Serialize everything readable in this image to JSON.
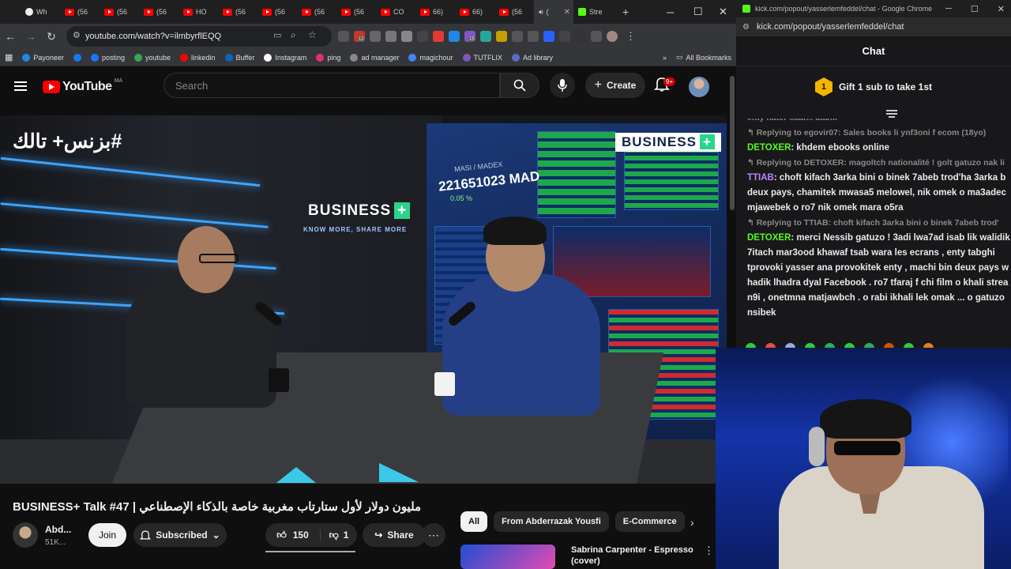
{
  "browser": {
    "tabs": [
      {
        "label": "Wh",
        "type": "chrome"
      },
      {
        "label": "(56",
        "type": "yt"
      },
      {
        "label": "(56",
        "type": "yt"
      },
      {
        "label": "(56",
        "type": "yt"
      },
      {
        "label": "HO",
        "type": "yt"
      },
      {
        "label": "(56",
        "type": "yt"
      },
      {
        "label": "(56",
        "type": "yt"
      },
      {
        "label": "(56",
        "type": "yt"
      },
      {
        "label": "(56",
        "type": "yt"
      },
      {
        "label": "CO",
        "type": "yt"
      },
      {
        "label": "66)",
        "type": "yt"
      },
      {
        "label": "66)",
        "type": "yt"
      },
      {
        "label": "(56",
        "type": "yt"
      },
      {
        "label": "(",
        "type": "audio",
        "active": true
      },
      {
        "label": "Stre",
        "type": "kick"
      }
    ],
    "url": "youtube.com/watch?v=ilmbyrflEQQ",
    "bookmarks": [
      "Payoneer",
      "posting",
      "youtube",
      "linkedin",
      "Buffer",
      "Instagram",
      "ping",
      "ad manager",
      "magichour",
      "TUTFLIX",
      "Ad library"
    ],
    "all_bookmarks": "All Bookmarks",
    "ext_badges": {
      "first": "12",
      "second": "15"
    }
  },
  "youtube": {
    "logo_word": "YouTube",
    "country": "MA",
    "search_placeholder": "Search",
    "create_label": "Create",
    "notif_count": "9+",
    "video": {
      "overlay_text": "#بزنس+ تالك",
      "brand": "BUSINESS",
      "brand_sub": "KNOW MORE, SHARE MORE",
      "index_label": "MASI / MADEX",
      "index_value": "221651023 MAD",
      "index_change": "0.05 %"
    },
    "title": "BUSINESS+ Talk #47 | مليون دولار لأول ستارتاب مغربية خاصة بالذكاء الإصطناعي",
    "channel": {
      "name": "Abd...",
      "subs": "51K..."
    },
    "join_label": "Join",
    "subscribed_label": "Subscribed",
    "likes": "150",
    "dislikes": "1",
    "share_label": "Share",
    "chips": [
      "All",
      "From Abderrazak Yousfi",
      "E-Commerce"
    ],
    "rec": {
      "title": "Sabrina Carpenter - Espresso (cover)"
    }
  },
  "kick": {
    "window_title": "kick.com/popout/yasserlemfeddel/chat - Google Chrome",
    "url": "kick.com/popout/yasserlemfeddel/chat",
    "chat_title": "Chat",
    "gift_count": "1",
    "gift_label": "Gift 1 sub to take 1st",
    "clipped_line": "enty hater oaar... atank",
    "messages": [
      {
        "reply": "Replying to egovir07: Sales books li ynf3oni f ecom (18yo)",
        "user": "DETOXER",
        "color": "#53fc18",
        "text": "khdem ebooks online"
      },
      {
        "reply": "Replying to DETOXER: magoltch nationalité ! golt gatuzo nak li",
        "user": "TTIAB",
        "color": "#c084fc",
        "text": "choft kifach 3arka bini o binek 7abeb trod'ha 3arka b deux pays, chamitek mwasa5 melowel, nik omek o ma3adec mjawebek o ro7 nik omek mara o5ra"
      },
      {
        "reply": "Replying to TTIAB: choft kifach 3arka bini o binek 7abeb trod'",
        "user": "DETOXER",
        "color": "#53fc18",
        "text": "merci Nessib gatuzo ! 3adi lwa7ad isab lik walidik 7itach mar3ood khawaf tsab wara les ecrans , enty tabghi tprovoki yasser ana provokitek enty , machi bin deux pays w hadik lhadra dyal Facebook . ro7 tfaraj f chi film o khali strea n9i , onetmna matjawbch . o rabi ikhali lek omak ... o gatuzo nsibek"
      }
    ]
  },
  "colors": {
    "yt_red": "#ff0000",
    "kick_green": "#53fc18",
    "gift_gold": "#f5b400"
  }
}
